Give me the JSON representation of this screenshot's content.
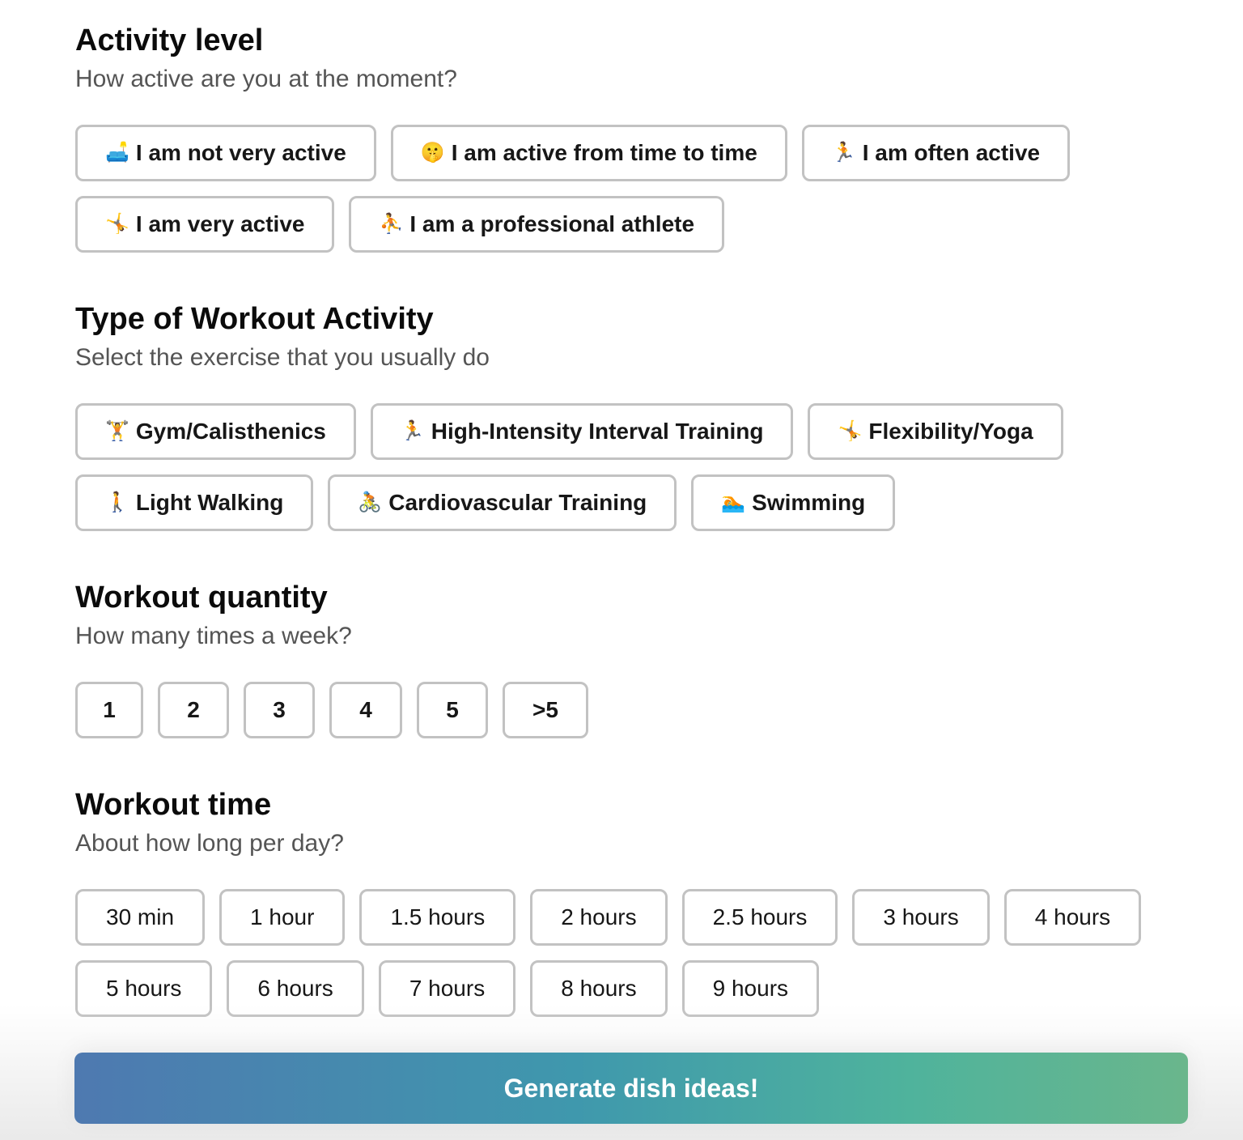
{
  "activity": {
    "title": "Activity level",
    "subtitle": "How active are you at the moment?",
    "options": [
      {
        "icon": "🛋️",
        "icon_name": "couch-icon",
        "label": "I am not very active"
      },
      {
        "icon": "🤫",
        "icon_name": "shushing-face-icon",
        "label": "I am active from time to time"
      },
      {
        "icon": "🏃",
        "icon_name": "running-person-icon",
        "label": "I am often active"
      },
      {
        "icon": "🤸",
        "icon_name": "cartwheel-person-icon",
        "label": "I am very active"
      },
      {
        "icon": "⛹️",
        "icon_name": "ball-player-icon",
        "label": "I am a professional athlete"
      }
    ]
  },
  "workout_type": {
    "title": "Type of Workout Activity",
    "subtitle": "Select the exercise that you usually do",
    "options": [
      {
        "icon": "🏋️",
        "icon_name": "weightlifter-icon",
        "label": "Gym/Calisthenics"
      },
      {
        "icon": "🏃",
        "icon_name": "running-person-icon",
        "label": "High-Intensity Interval Training"
      },
      {
        "icon": "🤸",
        "icon_name": "cartwheel-person-icon",
        "label": "Flexibility/Yoga"
      },
      {
        "icon": "🚶",
        "icon_name": "walking-person-icon",
        "label": "Light Walking"
      },
      {
        "icon": "🚴",
        "icon_name": "cyclist-icon",
        "label": "Cardiovascular Training"
      },
      {
        "icon": "🏊",
        "icon_name": "swimmer-icon",
        "label": "Swimming"
      }
    ]
  },
  "quantity": {
    "title": "Workout quantity",
    "subtitle": "How many times a week?",
    "options": [
      "1",
      "2",
      "3",
      "4",
      "5",
      ">5"
    ]
  },
  "time": {
    "title": "Workout time",
    "subtitle": "About how long per day?",
    "options": [
      "30 min",
      "1 hour",
      "1.5 hours",
      "2 hours",
      "2.5 hours",
      "3 hours",
      "4 hours",
      "5 hours",
      "6 hours",
      "7 hours",
      "8 hours",
      "9 hours"
    ]
  },
  "generate_label": "Generate dish ideas!",
  "colors": {
    "button_gradient_start": "#4e79b0",
    "button_gradient_end": "#6ab68c",
    "option_border": "#c2c2c2"
  }
}
